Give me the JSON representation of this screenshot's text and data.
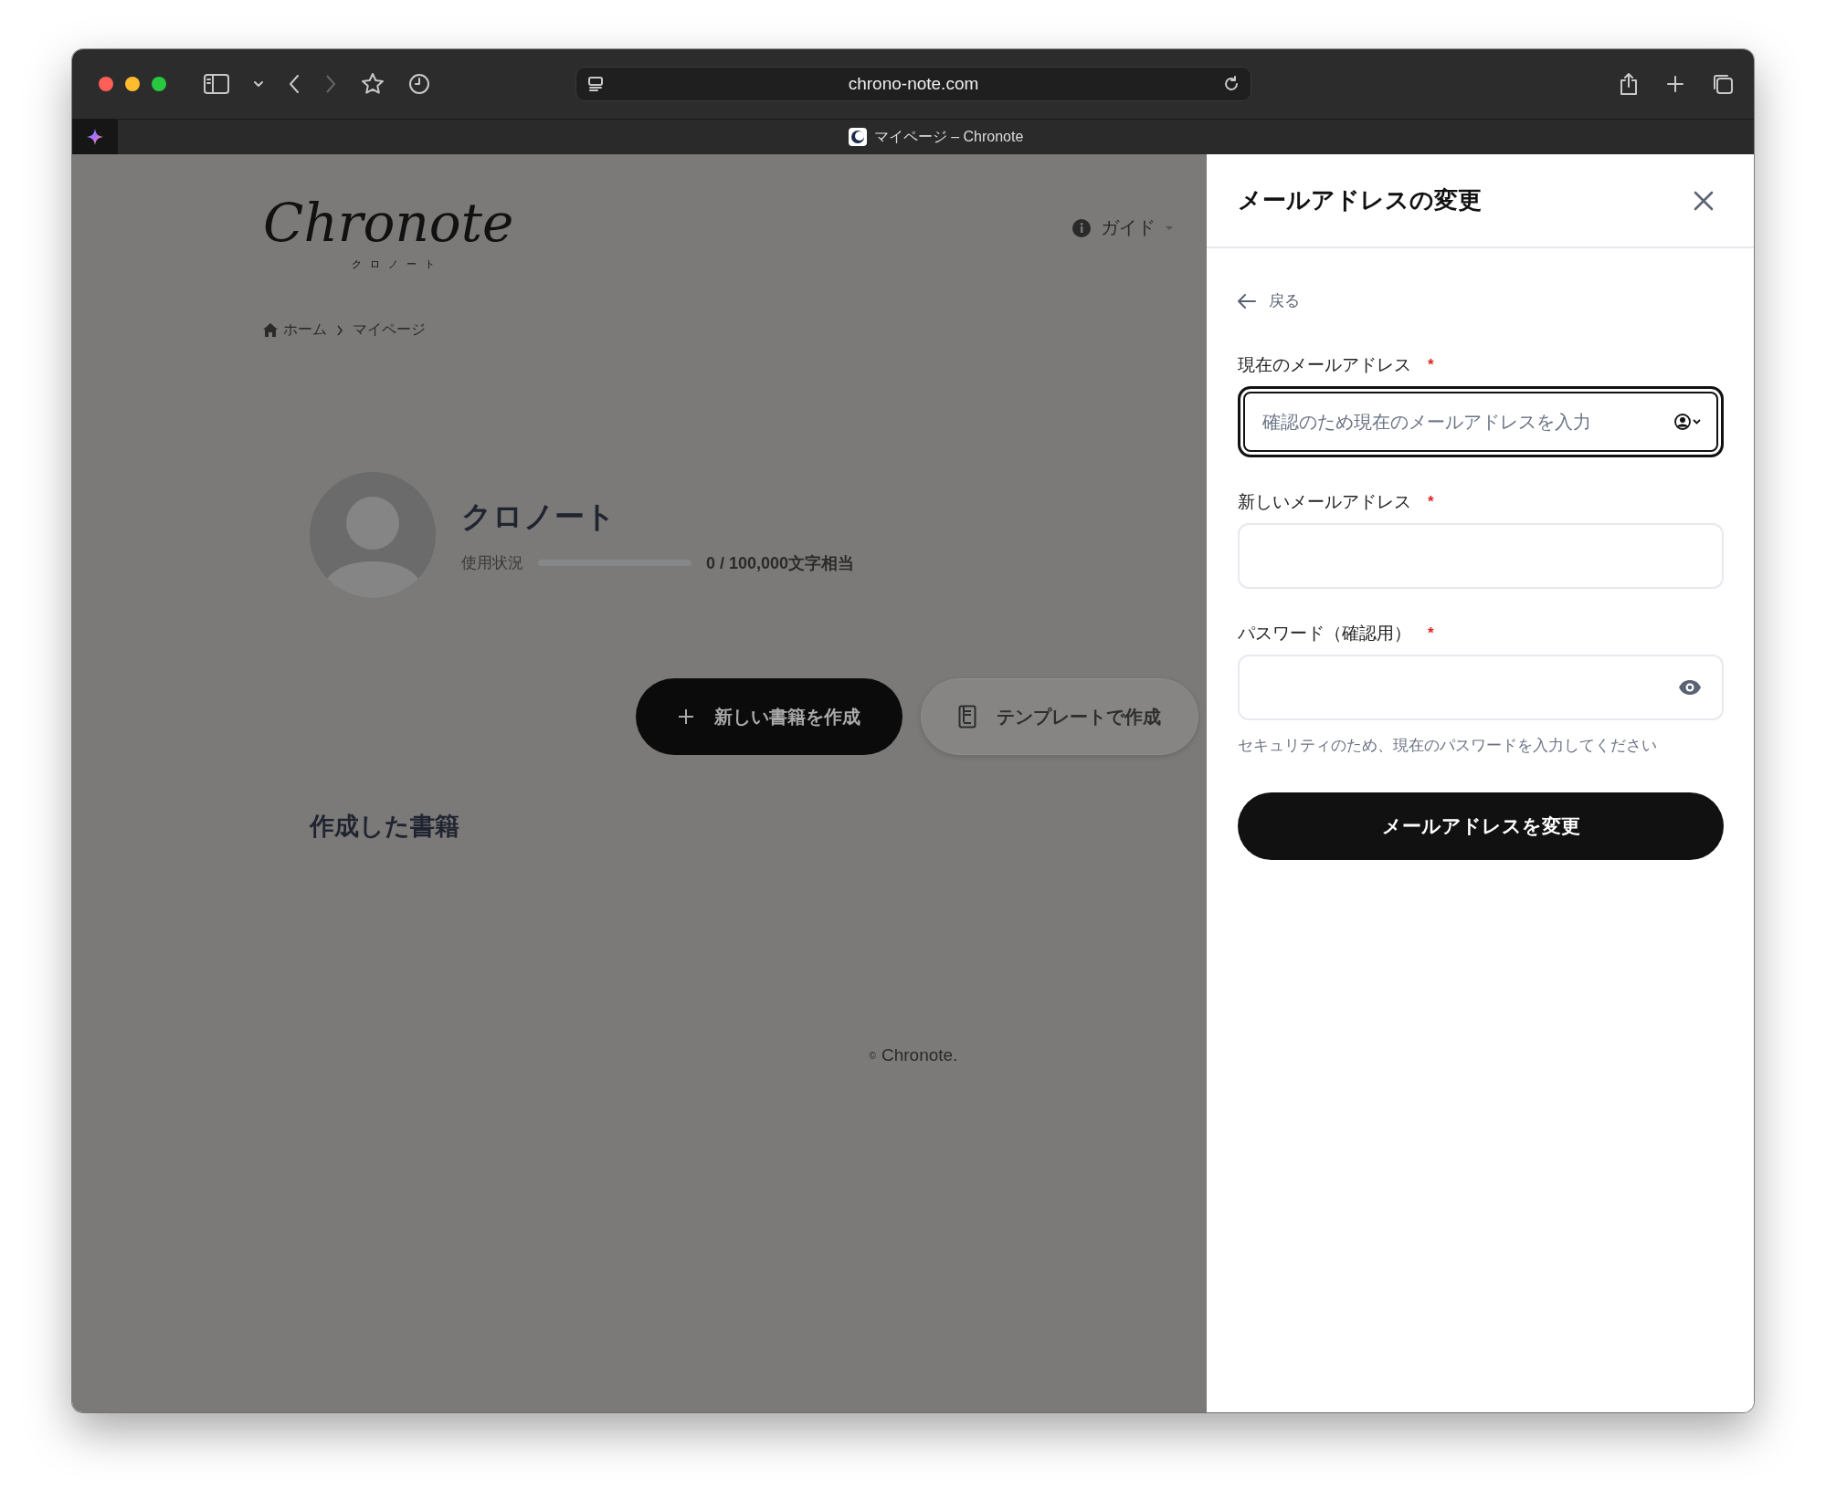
{
  "browser": {
    "url": "chrono-note.com",
    "tab_title": "マイページ – Chronote"
  },
  "page": {
    "logo": "Chronote",
    "logo_sub": "クロノート",
    "guide_menu": "ガイド",
    "breadcrumb": [
      "ホーム",
      "マイページ"
    ],
    "profile": {
      "name": "クロノート",
      "usage_label": "使用状況",
      "usage": {
        "level": 0
      },
      "usage_text": "0 / 100,000文字相当"
    },
    "actions": [
      {
        "kind": "primary",
        "label": "新しい書籍を作成"
      },
      {
        "kind": "secondary",
        "label": "テンプレートで作成"
      }
    ],
    "section_title": "作成した書籍",
    "footer": {
      "mark": "©",
      "text": "Chronote."
    }
  },
  "panel": {
    "title": "メールアドレスの変更",
    "back": "戻る",
    "fields": [
      {
        "kind": "autofill",
        "label": "現在のメールアドレス",
        "required_mark": "*",
        "placeholder": "確認のため現在のメールアドレスを入力",
        "focused": true
      },
      {
        "kind": "text",
        "label": "新しいメールアドレス",
        "required_mark": "*",
        "focused": false
      },
      {
        "kind": "password",
        "label": "パスワード（確認用）",
        "required_mark": "*",
        "focused": false
      }
    ],
    "hint": "セキュリティのため、現在のパスワードを入力してください",
    "submit": "メールアドレスを変更"
  }
}
